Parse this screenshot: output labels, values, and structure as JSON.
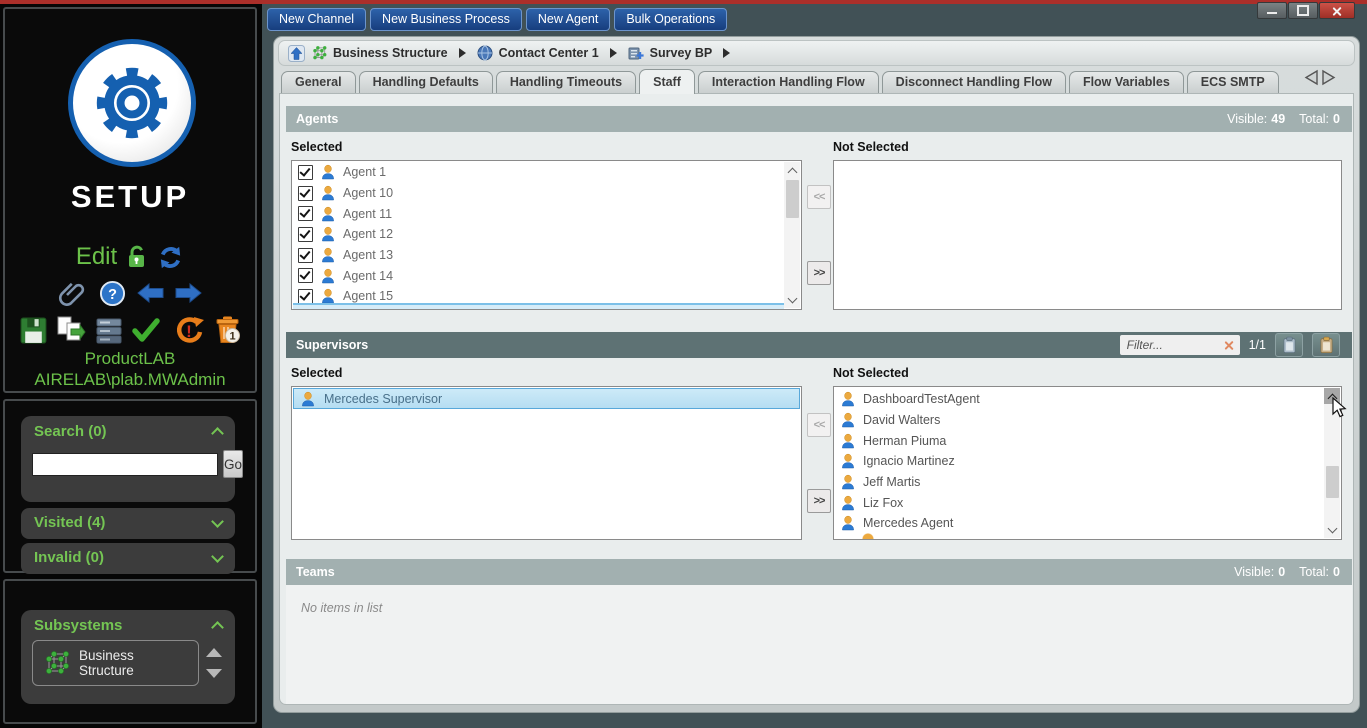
{
  "toolbar": {
    "buttons": [
      "New Channel",
      "New Business Process",
      "New Agent",
      "Bulk Operations"
    ]
  },
  "breadcrumb": {
    "items": [
      {
        "label": "Business Structure"
      },
      {
        "label": "Contact Center 1"
      },
      {
        "label": "Survey BP"
      }
    ]
  },
  "tabs": {
    "items": [
      "General",
      "Handling Defaults",
      "Handling Timeouts",
      "Staff",
      "Interaction Handling Flow",
      "Disconnect Handling Flow",
      "Flow Variables",
      "ECS SMTP"
    ],
    "active": "Staff"
  },
  "sidebar": {
    "logo_text": "SETUP",
    "edit_label": "Edit",
    "org_name": "ProductLAB",
    "user_name": "AIRELAB\\plab.MWAdmin",
    "search_title": "Search (0)",
    "search_value": "",
    "go_label": "Go",
    "visited_title": "Visited (4)",
    "invalid_title": "Invalid (0)",
    "subsystems_title": "Subsystems",
    "subsystem_items": [
      "Business Structure"
    ]
  },
  "agents": {
    "title": "Agents",
    "visible_label": "Visible:",
    "visible_value": "49",
    "total_label": "Total:",
    "total_value": "0",
    "selected_label": "Selected",
    "not_selected_label": "Not Selected",
    "selected_items": [
      "Agent 1",
      "Agent 10",
      "Agent 11",
      "Agent 12",
      "Agent 13",
      "Agent 14",
      "Agent 15"
    ],
    "move_remove_label": "<<",
    "move_add_label": ">>"
  },
  "supervisors": {
    "title": "Supervisors",
    "filter_placeholder": "Filter...",
    "pager": "1/1",
    "selected_label": "Selected",
    "not_selected_label": "Not Selected",
    "selected_items": [
      "Mercedes Supervisor"
    ],
    "not_selected_items": [
      "DashboardTestAgent",
      "David Walters",
      "Herman Piuma",
      "Ignacio Martinez",
      "Jeff Martis",
      "Liz Fox",
      "Mercedes Agent"
    ],
    "move_remove_label": "<<",
    "move_add_label": ">>"
  },
  "teams": {
    "title": "Teams",
    "visible_label": "Visible:",
    "visible_value": "0",
    "total_label": "Total:",
    "total_value": "0",
    "empty_text": "No items in list"
  },
  "colors": {
    "accent_green": "#6cc24a",
    "button_blue": "#1f4a8a",
    "header_gray": "#a2b0b0",
    "header_dark": "#5e7274",
    "selection_blue": "#b5ddf2"
  }
}
